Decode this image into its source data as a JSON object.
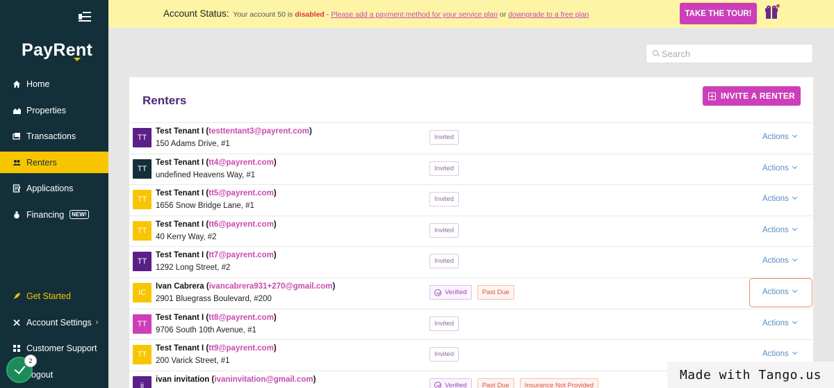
{
  "sidebar": {
    "logo": "PayRent",
    "items": [
      {
        "label": "Home",
        "icon": "home-icon"
      },
      {
        "label": "Properties",
        "icon": "properties-icon"
      },
      {
        "label": "Transactions",
        "icon": "transactions-icon"
      },
      {
        "label": "Renters",
        "icon": "renters-icon",
        "active": true
      },
      {
        "label": "Applications",
        "icon": "applications-icon"
      },
      {
        "label": "Financing",
        "icon": "financing-icon",
        "badge": "NEW!"
      }
    ],
    "bottom_items": [
      {
        "label": "Get Started",
        "icon": "rocket-icon"
      },
      {
        "label": "Account Settings",
        "icon": "wrench-icon"
      },
      {
        "label": "Customer Support",
        "icon": "support-icon"
      },
      {
        "label": "Logout",
        "icon": "logout-icon"
      }
    ]
  },
  "banner": {
    "label": "Account Status:",
    "text_before": "Your account 50 is",
    "status": "disabled",
    "dash": "-",
    "link1": "Please add a payment method for your service plan",
    "or": "or",
    "link2": "downgrade to a free plan",
    "tour_button": "TAKE THE TOUR!"
  },
  "search": {
    "placeholder": "Search"
  },
  "panel": {
    "title": "Renters",
    "invite_button": "INVITE A RENTER"
  },
  "renters": [
    {
      "initials": "TT",
      "avatar_color": "#5b1f88",
      "name": "Test Tenant I",
      "email": "testtentant3@payrent.com",
      "address": "150 Adams Drive, #1",
      "badges": [
        "Invited"
      ],
      "actions": "Actions"
    },
    {
      "initials": "TT",
      "avatar_color": "#13303a",
      "name": "Test Tenant I",
      "email": "tt4@payrent.com",
      "address": "undefined Heavens Way, #1",
      "badges": [
        "Invited"
      ],
      "actions": "Actions"
    },
    {
      "initials": "TT",
      "avatar_color": "#f7c600",
      "name": "Test Tenant I",
      "email": "tt5@payrent.com",
      "address": "1656 Snow Bridge Lane, #1",
      "badges": [
        "Invited"
      ],
      "actions": "Actions"
    },
    {
      "initials": "TT",
      "avatar_color": "#f7c600",
      "name": "Test Tenant I",
      "email": "tt6@payrent.com",
      "address": "40 Kerry Way, #2",
      "badges": [
        "Invited"
      ],
      "actions": "Actions"
    },
    {
      "initials": "TT",
      "avatar_color": "#5b1f88",
      "name": "Test Tenant I",
      "email": "tt7@payrent.com",
      "address": "1292 Long Street, #2",
      "badges": [
        "Invited"
      ],
      "actions": "Actions"
    },
    {
      "initials": "IC",
      "avatar_color": "#f7c600",
      "name": "Ivan Cabrera",
      "email": "ivancabrera931+270@gmail.com",
      "address": "2901 Bluegrass Boulevard, #200",
      "badges": [
        "Verified",
        "Past Due"
      ],
      "actions": "Actions"
    },
    {
      "initials": "TT",
      "avatar_color": "#cc3fb8",
      "name": "Test Tenant I",
      "email": "tt8@payrent.com",
      "address": "9706 South 10th Avenue, #1",
      "badges": [
        "Invited"
      ],
      "actions": "Actions"
    },
    {
      "initials": "TT",
      "avatar_color": "#f7c600",
      "name": "Test Tenant I",
      "email": "tt9@payrent.com",
      "address": "200 Varick Street, #1",
      "badges": [
        "Invited"
      ],
      "actions": "Actions"
    },
    {
      "initials": "ii",
      "avatar_color": "#5b1f88",
      "name": "ivan invitation",
      "email": "ivaninvitation@gmail.com",
      "address": "",
      "badges": [
        "Verified",
        "Past Due",
        "Insurance Not Provided"
      ],
      "actions": ""
    }
  ],
  "tango": {
    "count": "2",
    "watermark": "Made with Tango.us"
  },
  "colors": {
    "sidebar": "#13303a",
    "accent": "#cc3fb8",
    "active": "#f7c600",
    "banner": "#fdf4a6",
    "title": "#4d2777"
  }
}
